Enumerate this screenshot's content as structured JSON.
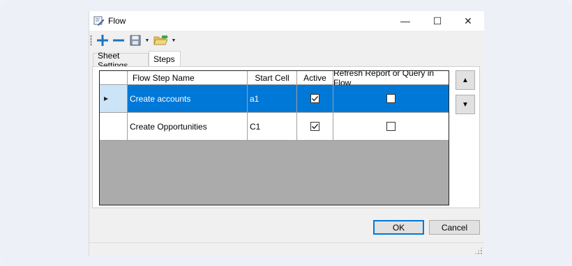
{
  "window": {
    "title": "Flow",
    "controls": {
      "minimize": "—",
      "maximize": "☐",
      "close": "✕"
    }
  },
  "toolbar": {
    "items": [
      {
        "name": "add",
        "icon": "plus-icon",
        "color": "#1e73be"
      },
      {
        "name": "remove",
        "icon": "minus-icon",
        "color": "#1e73be"
      },
      {
        "name": "save",
        "icon": "save-icon",
        "has_dropdown": true
      },
      {
        "name": "open",
        "icon": "folder-open-icon",
        "has_dropdown": true
      }
    ]
  },
  "tabs": [
    {
      "label": "Sheet Settings",
      "active": false
    },
    {
      "label": "Steps",
      "active": true
    }
  ],
  "grid": {
    "columns": [
      "Flow Step Name",
      "Start Cell",
      "Active",
      "Refresh Report or Query in Flow"
    ],
    "rows": [
      {
        "name": "Create accounts",
        "start_cell": "a1",
        "active": true,
        "refresh": false,
        "selected": true
      },
      {
        "name": "Create Opportunities",
        "start_cell": "C1",
        "active": true,
        "refresh": false,
        "selected": false
      }
    ],
    "selection_color": "#0078d7",
    "empty_area_color": "#ababab"
  },
  "side_buttons": {
    "up": "▲",
    "down": "▼"
  },
  "buttons": {
    "ok": "OK",
    "cancel": "Cancel"
  }
}
